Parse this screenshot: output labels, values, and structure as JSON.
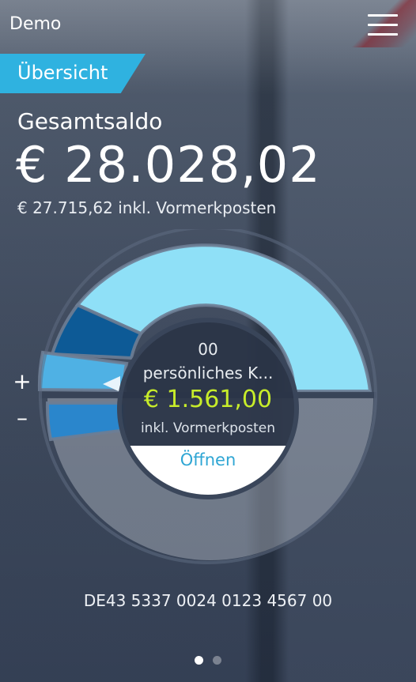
{
  "header": {
    "app_title": "Demo",
    "menu_icon": "hamburger-menu-icon"
  },
  "tab": {
    "label": "Übersicht"
  },
  "summary": {
    "label": "Gesamtsaldo",
    "amount": "€ 28.028,02",
    "pending": "€ 27.715,62 inkl. Vormerkposten"
  },
  "gauge": {
    "plus_label": "+",
    "minus_label": "–",
    "selected_color": "#8fe0f7",
    "segment_colors": [
      "#8fe0f7",
      "#0d5a96",
      "#4fb1e4",
      "#2a86cc"
    ]
  },
  "account": {
    "number": "00",
    "name": "persönliches K...",
    "balance": "€ 1.561,00",
    "pending": "inkl. Vormerkposten",
    "open_label": "Öffnen",
    "balance_color": "#c7ec2a"
  },
  "footer": {
    "iban": "DE43 5337 0024 0123 4567 00",
    "page_dots": [
      true,
      false
    ]
  },
  "colors": {
    "accent": "#2fb2e0"
  }
}
